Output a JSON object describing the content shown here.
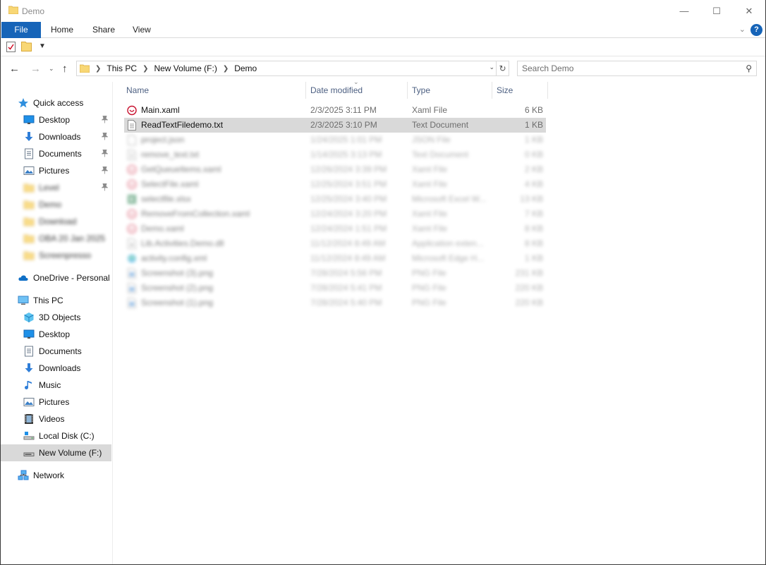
{
  "window": {
    "title": "Demo",
    "min_glyph": "—",
    "max_glyph": "☐",
    "close_glyph": "✕"
  },
  "ribbon": {
    "tabs": [
      "File",
      "Home",
      "Share",
      "View"
    ],
    "help_glyph": "?"
  },
  "address": {
    "crumbs": [
      "This PC",
      "New Volume (F:)",
      "Demo"
    ],
    "refresh_glyph": "↻"
  },
  "search": {
    "placeholder": "Search Demo"
  },
  "nav_pane": {
    "items": [
      {
        "label": "Quick access",
        "icon": "star-icon",
        "pinned": false,
        "blurred": false
      },
      {
        "label": "Desktop",
        "icon": "desktop-icon",
        "pinned": true,
        "blurred": false
      },
      {
        "label": "Downloads",
        "icon": "download-icon",
        "pinned": true,
        "blurred": false
      },
      {
        "label": "Documents",
        "icon": "documents-icon",
        "pinned": true,
        "blurred": false
      },
      {
        "label": "Pictures",
        "icon": "pictures-icon",
        "pinned": true,
        "blurred": false
      },
      {
        "label": "Level",
        "icon": "folder-icon",
        "pinned": true,
        "blurred": true
      },
      {
        "label": "Demo",
        "icon": "folder-icon",
        "pinned": false,
        "blurred": true
      },
      {
        "label": "Download",
        "icon": "folder-icon",
        "pinned": false,
        "blurred": true
      },
      {
        "label": "OBA 20 Jan 2025",
        "icon": "folder-icon",
        "pinned": false,
        "blurred": true
      },
      {
        "label": "Screenpresso",
        "icon": "folder-icon",
        "pinned": false,
        "blurred": true
      },
      {
        "label": "OneDrive - Personal",
        "icon": "cloud-icon",
        "pinned": false,
        "blurred": false
      },
      {
        "label": "This PC",
        "icon": "pc-icon",
        "pinned": false,
        "blurred": false
      },
      {
        "label": "3D Objects",
        "icon": "cube-icon",
        "pinned": false,
        "blurred": false
      },
      {
        "label": "Desktop",
        "icon": "desktop-icon",
        "pinned": false,
        "blurred": false
      },
      {
        "label": "Documents",
        "icon": "documents-icon",
        "pinned": false,
        "blurred": false
      },
      {
        "label": "Downloads",
        "icon": "download-icon",
        "pinned": false,
        "blurred": false
      },
      {
        "label": "Music",
        "icon": "music-icon",
        "pinned": false,
        "blurred": false
      },
      {
        "label": "Pictures",
        "icon": "pictures-icon",
        "pinned": false,
        "blurred": false
      },
      {
        "label": "Videos",
        "icon": "videos-icon",
        "pinned": false,
        "blurred": false
      },
      {
        "label": "Local Disk (C:)",
        "icon": "local-disk-icon",
        "pinned": false,
        "blurred": false
      },
      {
        "label": "New Volume (F:)",
        "icon": "drive-icon",
        "pinned": false,
        "blurred": false,
        "selected": true
      },
      {
        "label": "Network",
        "icon": "network-icon",
        "pinned": false,
        "blurred": false
      }
    ]
  },
  "file_list": {
    "columns": [
      "Name",
      "Date modified",
      "Type",
      "Size"
    ],
    "rows": [
      {
        "name": "Main.xaml",
        "date": "2/3/2025 3:11 PM",
        "type": "Xaml File",
        "size": "6 KB",
        "icon": "xaml-icon",
        "dim": false,
        "selected": false
      },
      {
        "name": "ReadTextFiledemo.txt",
        "date": "2/3/2025 3:10 PM",
        "type": "Text Document",
        "size": "1 KB",
        "icon": "text-file-icon",
        "dim": false,
        "selected": true
      },
      {
        "name": "project.json",
        "date": "1/24/2025 1:01 PM",
        "type": "JSON File",
        "size": "1 KB",
        "icon": "json-file-icon",
        "dim": true,
        "selected": false
      },
      {
        "name": "remove_text.txt",
        "date": "1/14/2025 3:13 PM",
        "type": "Text Document",
        "size": "0 KB",
        "icon": "text-file-icon",
        "dim": true,
        "selected": false
      },
      {
        "name": "GetQueueItems.xaml",
        "date": "12/26/2024 3:39 PM",
        "type": "Xaml File",
        "size": "2 KB",
        "icon": "xaml-icon",
        "dim": true,
        "selected": false
      },
      {
        "name": "SelectFile.xaml",
        "date": "12/25/2024 3:51 PM",
        "type": "Xaml File",
        "size": "4 KB",
        "icon": "xaml-icon",
        "dim": true,
        "selected": false
      },
      {
        "name": "selectfile.xlsx",
        "date": "12/25/2024 3:40 PM",
        "type": "Microsoft Excel W...",
        "size": "13 KB",
        "icon": "excel-icon",
        "dim": true,
        "selected": false
      },
      {
        "name": "RemoveFromCollection.xaml",
        "date": "12/24/2024 3:20 PM",
        "type": "Xaml File",
        "size": "7 KB",
        "icon": "xaml-icon",
        "dim": true,
        "selected": false
      },
      {
        "name": "Demo.xaml",
        "date": "12/24/2024 1:51 PM",
        "type": "Xaml File",
        "size": "8 KB",
        "icon": "xaml-icon",
        "dim": true,
        "selected": false
      },
      {
        "name": "Lib.Activities.Demo.dll",
        "date": "11/12/2024 8:49 AM",
        "type": "Application exten...",
        "size": "8 KB",
        "icon": "dll-icon",
        "dim": true,
        "selected": false
      },
      {
        "name": "activity.config.xml",
        "date": "11/12/2024 8:49 AM",
        "type": "Microsoft Edge H...",
        "size": "1 KB",
        "icon": "edge-xml-icon",
        "dim": true,
        "selected": false
      },
      {
        "name": "Screenshot (3).png",
        "date": "7/28/2024 5:56 PM",
        "type": "PNG File",
        "size": "231 KB",
        "icon": "image-file-icon",
        "dim": true,
        "selected": false
      },
      {
        "name": "Screenshot (2).png",
        "date": "7/28/2024 5:41 PM",
        "type": "PNG File",
        "size": "220 KB",
        "icon": "image-file-icon",
        "dim": true,
        "selected": false
      },
      {
        "name": "Screenshot (1).png",
        "date": "7/28/2024 5:40 PM",
        "type": "PNG File",
        "size": "220 KB",
        "icon": "image-file-icon",
        "dim": true,
        "selected": false
      }
    ]
  },
  "colors": {
    "accent": "#1664b8",
    "selection": "#d9d9d9",
    "header_text": "#4d6082",
    "folder_yellow": "#f8d775",
    "xaml_red": "#d0021b"
  }
}
